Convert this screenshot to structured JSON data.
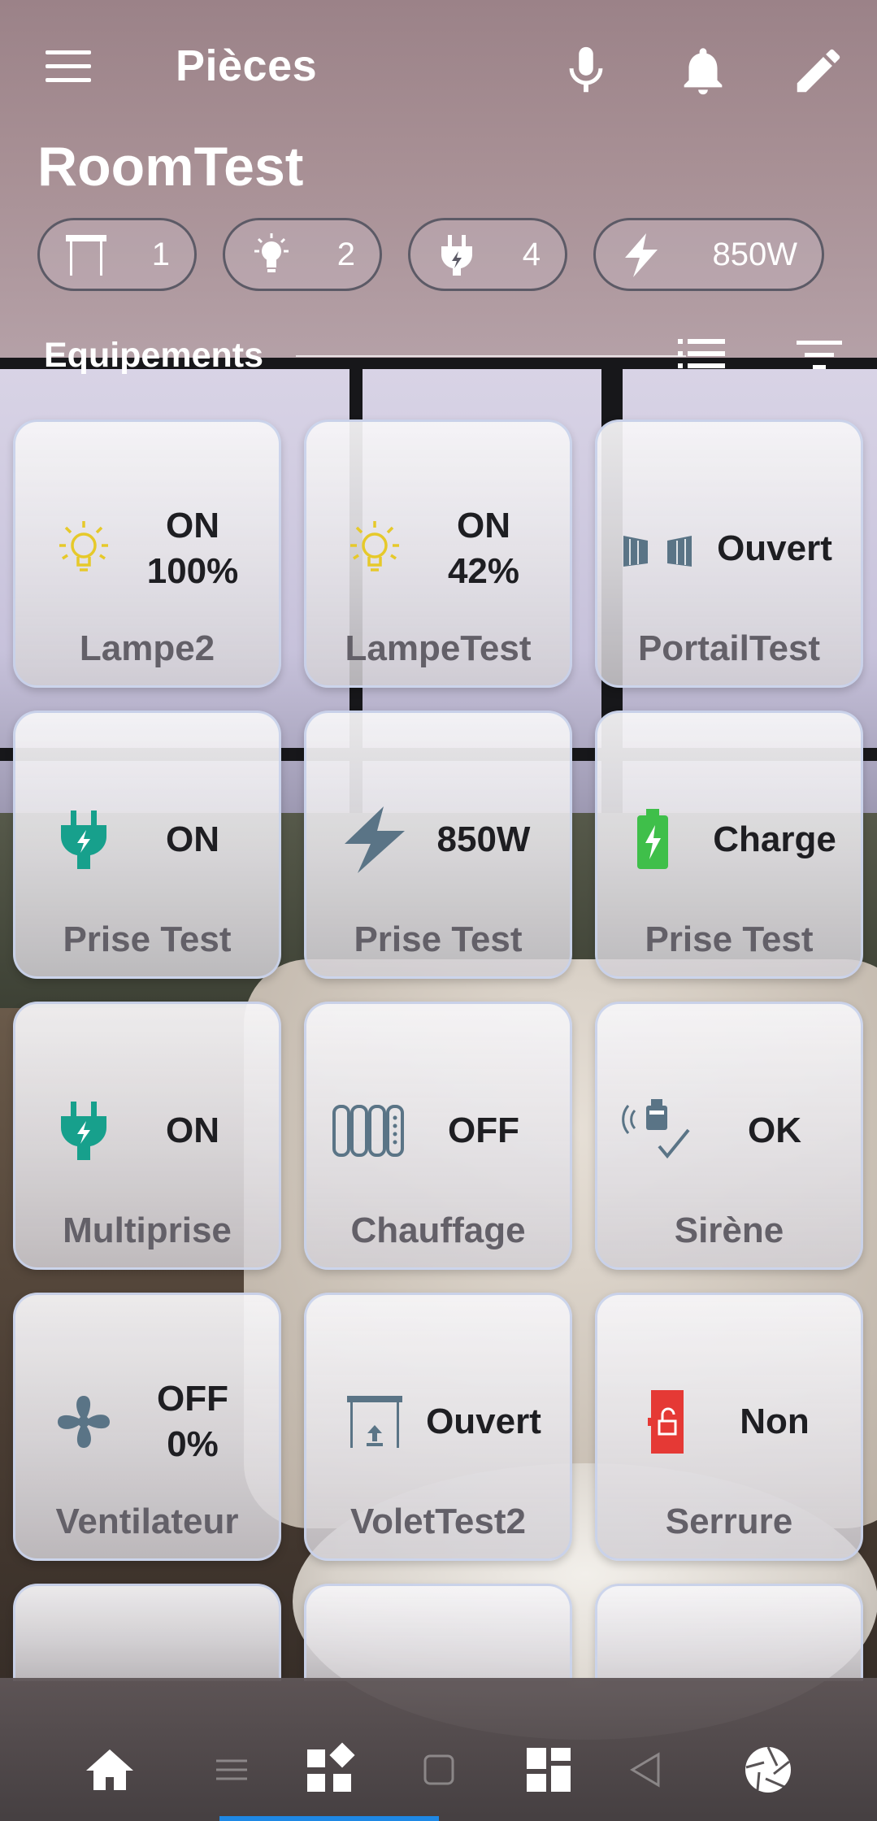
{
  "header": {
    "title": "Pièces",
    "room_name": "RoomTest"
  },
  "summary_chips": [
    {
      "icon": "shutter-icon",
      "value": "1"
    },
    {
      "icon": "bulb-icon",
      "value": "2"
    },
    {
      "icon": "plug-icon",
      "value": "4"
    },
    {
      "icon": "lightning-icon",
      "value": "850W"
    }
  ],
  "section": {
    "label": "Equipements"
  },
  "devices": [
    {
      "name": "Lampe2",
      "state_line1": "ON",
      "state_line2": "100%",
      "icon": "bulb-icon"
    },
    {
      "name": "LampeTest",
      "state_line1": "ON",
      "state_line2": "42%",
      "icon": "bulb-icon"
    },
    {
      "name": "PortailTest",
      "state_line1": "Ouvert",
      "state_line2": "",
      "icon": "gate-icon"
    },
    {
      "name": "Prise Test",
      "state_line1": "ON",
      "state_line2": "",
      "icon": "plug-icon"
    },
    {
      "name": "Prise Test",
      "state_line1": "850W",
      "state_line2": "",
      "icon": "lightning-icon"
    },
    {
      "name": "Prise Test",
      "state_line1": "Charge",
      "state_line2": "",
      "icon": "battery-icon"
    },
    {
      "name": "Multiprise",
      "state_line1": "ON",
      "state_line2": "",
      "icon": "plug-icon"
    },
    {
      "name": "Chauffage",
      "state_line1": "OFF",
      "state_line2": "",
      "icon": "radiator-icon"
    },
    {
      "name": "Sirène",
      "state_line1": "OK",
      "state_line2": "",
      "icon": "siren-icon"
    },
    {
      "name": "Ventilateur",
      "state_line1": "OFF",
      "state_line2": "0%",
      "icon": "fan-icon"
    },
    {
      "name": "VoletTest2",
      "state_line1": "Ouvert",
      "state_line2": "",
      "icon": "shutter-icon"
    },
    {
      "name": "Serrure",
      "state_line1": "Non",
      "state_line2": "",
      "icon": "lock-icon"
    }
  ],
  "colors": {
    "bulb": "#e6c92a",
    "plug": "#17a08c",
    "slate": "#5a7486",
    "battery": "#3fbf4a",
    "lock": "#e53935",
    "nav_active": "#1e88e5"
  }
}
